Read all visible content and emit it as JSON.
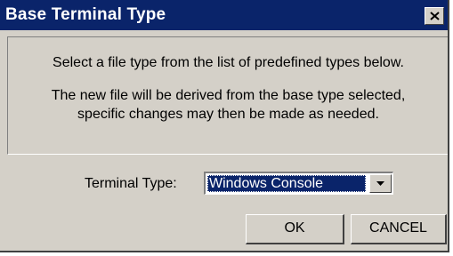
{
  "window": {
    "title": "Base Terminal Type"
  },
  "message": {
    "line1": "Select a file type from the list of predefined types below.",
    "line2": "The new file will be derived from the base type selected,",
    "line3": "specific changes may then be made as needed."
  },
  "terminal_type": {
    "label": "Terminal Type:",
    "selected": "Windows Console"
  },
  "buttons": {
    "ok": "OK",
    "cancel": "CANCEL"
  },
  "colors": {
    "titlebar": "#0a246a",
    "face": "#d4d0c8",
    "selection": "#0a246a"
  },
  "icons": {
    "close": "close-icon",
    "dropdown": "chevron-down-icon"
  }
}
